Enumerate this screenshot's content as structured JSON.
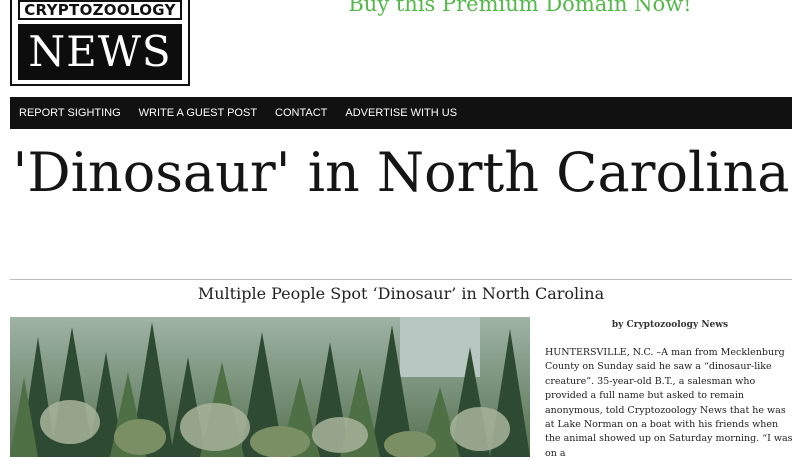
{
  "logo": {
    "top_text": "CRYPTOZOOLOGY",
    "bottom_text": "NEWS"
  },
  "promo": {
    "text": "Buy this Premium Domain Now!",
    "color": "#55b84a"
  },
  "nav": {
    "items": [
      {
        "label": "REPORT SIGHTING"
      },
      {
        "label": "WRITE A GUEST POST"
      },
      {
        "label": "CONTACT"
      },
      {
        "label": "ADVERTISE WITH US"
      }
    ]
  },
  "article": {
    "headline": "'Dinosaur' in North Carolina",
    "subheadline": "Multiple People Spot ‘Dinosaur’ in North Carolina",
    "byline": "by Cryptozoology News",
    "body": "HUNTERSVILLE, N.C. –A man from Mecklenburg County on Sunday said he saw a “dinosaur-like creature”. 35-year-old B.T., a salesman who provided a full name but asked to remain anonymous, told Cryptozoology News that he was at Lake Norman on a boat with his friends when the animal showed up on Saturday morning. “I was on a"
  },
  "photo": {
    "subject": "forest-trees-image"
  }
}
